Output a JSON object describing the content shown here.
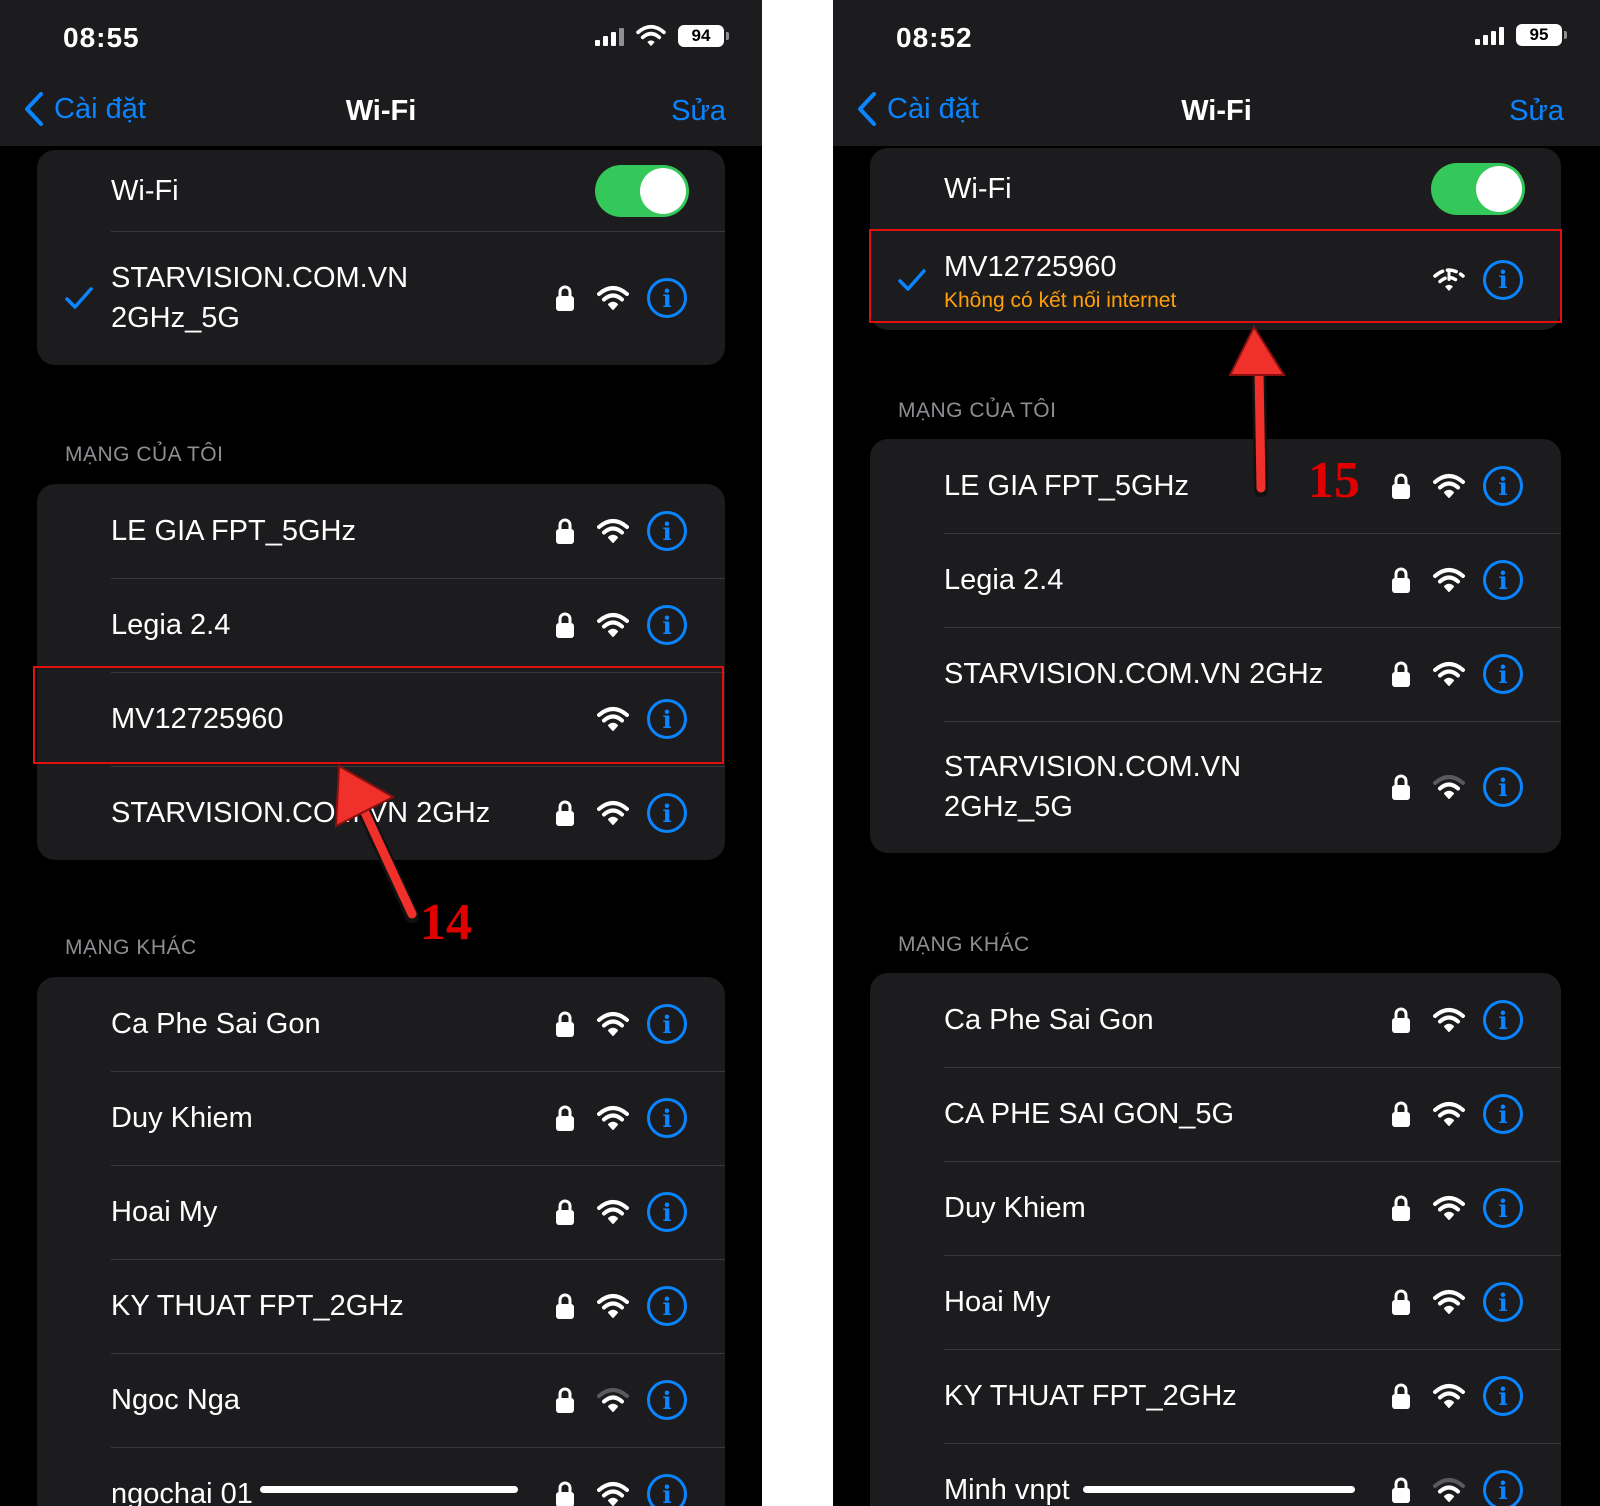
{
  "colors": {
    "accent": "#0a84ff",
    "toggle_on": "#34c759",
    "warning": "#ff9f0a",
    "annotation": "#e00000"
  },
  "left": {
    "status": {
      "time": "08:55",
      "battery": "94"
    },
    "nav": {
      "back_label": "Cài đặt",
      "title": "Wi-Fi",
      "edit_label": "Sửa"
    },
    "wifi_toggle": {
      "label": "Wi-Fi",
      "on": true
    },
    "connected": {
      "lines": [
        "STARVISION.COM.VN",
        "2GHz_5G"
      ],
      "locked": true
    },
    "my_networks": {
      "header": "MẠNG CỦA TÔI",
      "items": [
        {
          "name": "LE GIA FPT_5GHz",
          "locked": true,
          "signal": "full"
        },
        {
          "name": "Legia 2.4",
          "locked": true,
          "signal": "full"
        },
        {
          "name": "MV12725960",
          "locked": false,
          "signal": "full",
          "highlighted": true
        },
        {
          "name": "STARVISION.COM.VN 2GHz",
          "locked": true,
          "signal": "full"
        }
      ]
    },
    "other_networks": {
      "header": "MẠNG KHÁC",
      "items": [
        {
          "name": "Ca Phe Sai Gon",
          "locked": true,
          "signal": "full"
        },
        {
          "name": "Duy Khiem",
          "locked": true,
          "signal": "full"
        },
        {
          "name": "Hoai My",
          "locked": true,
          "signal": "full"
        },
        {
          "name": "KY THUAT FPT_2GHz",
          "locked": true,
          "signal": "full"
        },
        {
          "name": "Ngoc Nga",
          "locked": true,
          "signal": "weak"
        },
        {
          "name": "ngochai 01",
          "locked": true,
          "signal": "full"
        }
      ]
    },
    "annotation": {
      "number": "14"
    }
  },
  "right": {
    "status": {
      "time": "08:52",
      "battery": "95"
    },
    "nav": {
      "back_label": "Cài đặt",
      "title": "Wi-Fi",
      "edit_label": "Sửa"
    },
    "wifi_toggle": {
      "label": "Wi-Fi",
      "on": true
    },
    "connected": {
      "name": "MV12725960",
      "status": "Không có kết nối internet",
      "locked": false
    },
    "my_networks": {
      "header": "MẠNG CỦA TÔI",
      "items": [
        {
          "name": "LE GIA FPT_5GHz",
          "locked": true,
          "signal": "full"
        },
        {
          "name": "Legia 2.4",
          "locked": true,
          "signal": "full"
        },
        {
          "name": "STARVISION.COM.VN 2GHz",
          "locked": true,
          "signal": "full"
        },
        {
          "lines": [
            "STARVISION.COM.VN",
            "2GHz_5G"
          ],
          "locked": true,
          "signal": "weak"
        }
      ]
    },
    "other_networks": {
      "header": "MẠNG KHÁC",
      "items": [
        {
          "name": "Ca Phe Sai Gon",
          "locked": true,
          "signal": "full"
        },
        {
          "name": "CA PHE SAI GON_5G",
          "locked": true,
          "signal": "full"
        },
        {
          "name": "Duy Khiem",
          "locked": true,
          "signal": "full"
        },
        {
          "name": "Hoai My",
          "locked": true,
          "signal": "full"
        },
        {
          "name": "KY THUAT FPT_2GHz",
          "locked": true,
          "signal": "full"
        },
        {
          "name": "Minh vnpt",
          "locked": true,
          "signal": "weak"
        }
      ]
    },
    "annotation": {
      "number": "15"
    }
  }
}
